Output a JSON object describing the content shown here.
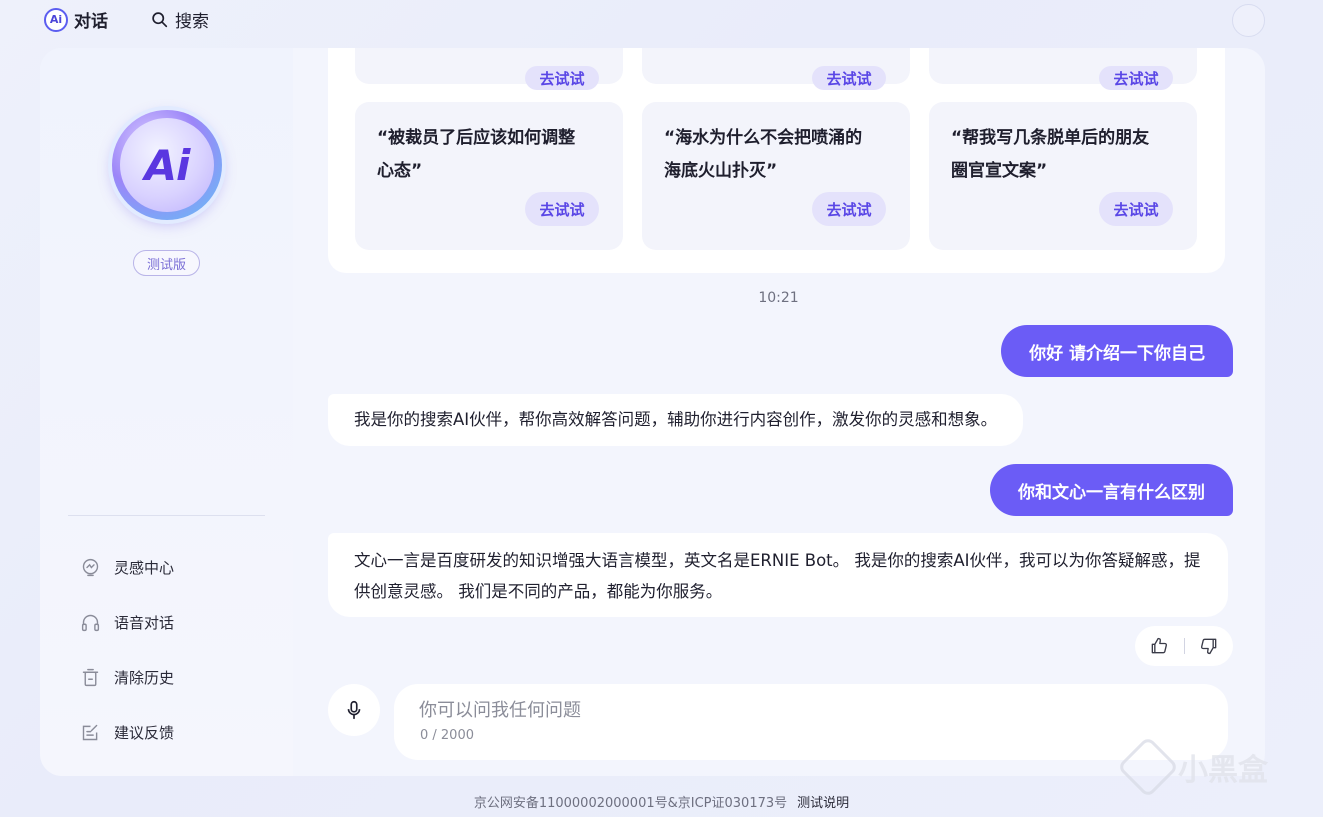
{
  "nav": {
    "chat": "对话",
    "search": "搜索",
    "logo_text": "Ai"
  },
  "sidebar": {
    "logo_text": "Ai",
    "badge": "测试版",
    "items": [
      {
        "label": "灵感中心",
        "icon": "lightbulb-icon"
      },
      {
        "label": "语音对话",
        "icon": "headphones-icon"
      },
      {
        "label": "清除历史",
        "icon": "trash-icon"
      },
      {
        "label": "建议反馈",
        "icon": "feedback-icon"
      }
    ]
  },
  "prompt_cards": {
    "try_label": "去试试",
    "items": [
      {
        "text": "“被裁员了后应该如何调整心态”"
      },
      {
        "text": "“海水为什么不会把喷涌的海底火山扑灭”"
      },
      {
        "text": "“帮我写几条脱单后的朋友圈官宣文案”"
      }
    ]
  },
  "chat": {
    "timestamp": "10:21",
    "messages": [
      {
        "role": "user",
        "text": "你好 请介绍一下你自己"
      },
      {
        "role": "bot",
        "text": "我是你的搜索AI伙伴，帮你高效解答问题，辅助你进行内容创作，激发你的灵感和想象。"
      },
      {
        "role": "user",
        "text": "你和文心一言有什么区别"
      },
      {
        "role": "bot",
        "text": "文心一言是百度研发的知识增强大语言模型，英文名是ERNIE Bot。 我是你的搜索AI伙伴，我可以为你答疑解惑，提供创意灵感。 我们是不同的产品，都能为你服务。"
      }
    ]
  },
  "input": {
    "placeholder": "你可以问我任何问题",
    "count": "0 / 2000"
  },
  "footer": {
    "icp": "京公网安备11000002000001号&京ICP证030173号",
    "help": "测试说明"
  },
  "watermark": "小黑盒",
  "colors": {
    "accent": "#6b5cf6",
    "try_bg": "#e4e2fb",
    "page_bg": "#eef1fb"
  }
}
